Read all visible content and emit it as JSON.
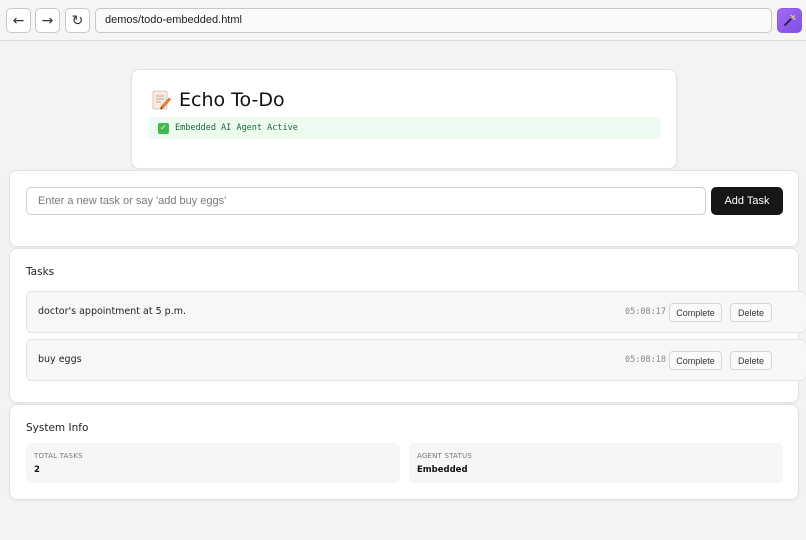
{
  "browser": {
    "back": "←",
    "forward": "→",
    "reload": "↻",
    "url": "demos/todo-embedded.html",
    "extension_icon": "magic-wand-icon",
    "accent": "#8a5be8"
  },
  "header": {
    "icon": "memo-icon",
    "title": "Echo To-Do",
    "status_check": "✓",
    "status_text": "Embedded AI Agent Active",
    "status_color": "#3fb950"
  },
  "input": {
    "placeholder": "Enter a new task or say 'add buy eggs'",
    "value": "",
    "add_label": "Add Task"
  },
  "tasks": {
    "title": "Tasks",
    "items": [
      {
        "text": "doctor's appointment at 5 p.m.",
        "time": "05:08:17",
        "complete_label": "Complete",
        "delete_label": "Delete"
      },
      {
        "text": "buy eggs",
        "time": "05:08:18",
        "complete_label": "Complete",
        "delete_label": "Delete"
      }
    ]
  },
  "system_info": {
    "title": "System Info",
    "total_tasks_label": "Total Tasks",
    "total_tasks_value": "2",
    "agent_status_label": "Agent Status",
    "agent_status_value": "Embedded"
  }
}
